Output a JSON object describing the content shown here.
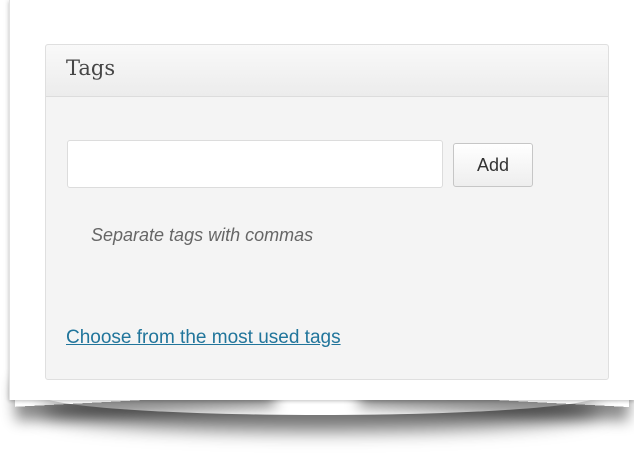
{
  "tags_box": {
    "title": "Tags",
    "input": {
      "value": "",
      "placeholder": ""
    },
    "add_label": "Add",
    "hint": "Separate tags with commas",
    "most_used_link": "Choose from the most used tags"
  },
  "colors": {
    "link": "#21759b",
    "box_background": "#f4f4f4",
    "hint_text": "#666666"
  }
}
